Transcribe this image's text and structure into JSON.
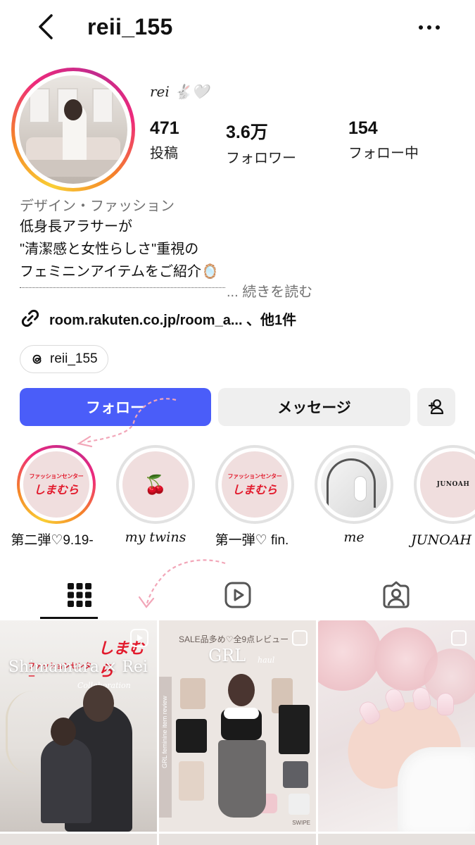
{
  "header": {
    "username": "reii_155",
    "back_icon": "chevron-left-icon",
    "more_icon": "ellipsis-icon"
  },
  "profile": {
    "display_name": "rei 🐇🤍",
    "stats": [
      {
        "value": "471",
        "label": "投稿"
      },
      {
        "value": "3.6万",
        "label": "フォロワー"
      },
      {
        "value": "154",
        "label": "フォロー中"
      }
    ],
    "category": "デザイン・ファッション",
    "bio": "低身長アラサーが\n\"清潔感と女性らしさ\"重視の\nフェミニンアイテムをご紹介🪞",
    "more_label": "... 続きを読む",
    "link_text": "room.rakuten.co.jp/room_a... 、他1件",
    "threads_handle": "reii_155"
  },
  "actions": {
    "follow_label": "フォロー",
    "message_label": "メッセージ",
    "add_user_icon": "add-person-icon"
  },
  "highlights": [
    {
      "label": "第二弾♡9.19-",
      "cover": "しまむら",
      "cover_small": "ファッションセンター",
      "active": true
    },
    {
      "label": "my twins",
      "cover": "🍒",
      "active": false
    },
    {
      "label": "第一弾♡ fin.",
      "cover": "しまむら",
      "cover_small": "ファッションセンター",
      "active": false
    },
    {
      "label": "me",
      "cover": "",
      "active": false
    },
    {
      "label": "JUNOAH コ",
      "cover": "JUNOAH",
      "active": false
    }
  ],
  "tabs": [
    {
      "name": "posts",
      "icon": "grid-icon",
      "active": true
    },
    {
      "name": "reels",
      "icon": "reels-icon",
      "active": false
    },
    {
      "name": "tagged",
      "icon": "tagged-icon",
      "active": false
    }
  ],
  "posts": [
    {
      "type": "reel",
      "brand_small": "ファッションセンター",
      "brand": "しまむら",
      "title": "Shimamura × Rei",
      "subtitle": "Collaboration"
    },
    {
      "type": "carousel",
      "top_text": "SALE品多め♡全9点レビュー",
      "title": "GRL",
      "title_suffix": "haul",
      "side_text": "GRL feminine item review",
      "swipe": "SWIPE"
    },
    {
      "type": "carousel"
    }
  ],
  "colors": {
    "follow_button": "#4a5df9",
    "secondary_button": "#efefef",
    "muted_text": "#737373",
    "brand_red": "#e21b2d"
  }
}
